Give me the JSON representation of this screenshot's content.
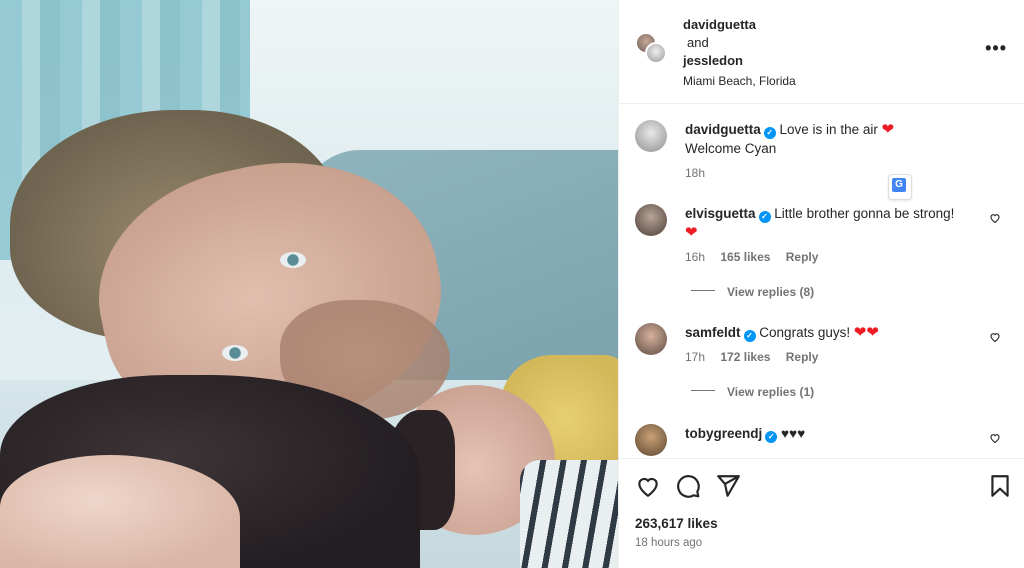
{
  "post_header": {
    "user1": "davidguetta",
    "conjunction": "and",
    "user2": "jessledon",
    "location": "Miami Beach, Florida",
    "more_icon": "more-icon",
    "more_label": "•••"
  },
  "caption": {
    "username": "davidguetta",
    "text": "Love is in the air",
    "emoji": "❤",
    "line2": "Welcome Cyan",
    "time": "18h"
  },
  "comments": [
    {
      "username": "elvisguetta",
      "text": "Little brother gonna be strong!",
      "emoji": "❤",
      "time": "16h",
      "likes": "165 likes",
      "reply": "Reply",
      "view_replies": "View replies (8)"
    },
    {
      "username": "samfeldt",
      "text": "Congrats guys!",
      "emoji": "❤❤",
      "time": "17h",
      "likes": "172 likes",
      "reply": "Reply",
      "view_replies": "View replies (1)"
    },
    {
      "username": "tobygreendj",
      "text": "♥♥♥"
    }
  ],
  "actions": {
    "likes": "263,617 likes",
    "time_ago": "18 hours ago"
  },
  "colors": {
    "verified": "#0095f6",
    "heart": "#ed1c24",
    "muted": "#737373"
  }
}
